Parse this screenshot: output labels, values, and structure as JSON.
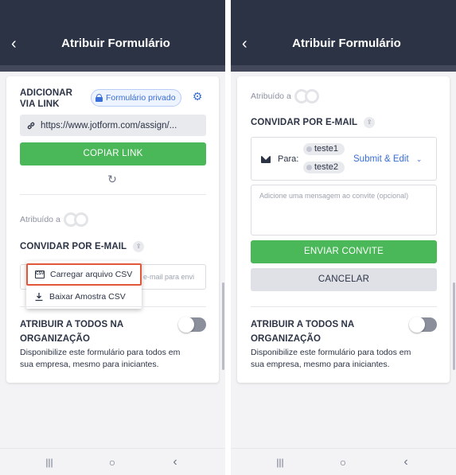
{
  "left": {
    "header": {
      "back": "‹",
      "title": "Atribuir Formulário"
    },
    "add_link": {
      "title": "ADICIONAR VIA LINK",
      "badge": "Formulário privado",
      "url": "https://www.jotform.com/assign/...",
      "copy_button": "COPIAR LINK"
    },
    "assigned_label": "Atribuído a",
    "invite_title": "CONVIDAR POR E-MAIL",
    "email_placeholder": "e-mail para envi",
    "dropdown": {
      "upload_csv": "Carregar arquivo CSV",
      "download_sample": "Baixar Amostra CSV"
    },
    "org": {
      "title": "ATRIBUIR A TODOS NA ORGANIZAÇÃO",
      "desc": "Disponibilize este formulário para todos em sua empresa, mesmo para iniciantes."
    }
  },
  "right": {
    "header": {
      "back": "‹",
      "title": "Atribuir Formulário"
    },
    "assigned_label": "Atribuído a",
    "invite_title": "CONVIDAR POR E-MAIL",
    "to_label": "Para:",
    "recipients": [
      "teste1",
      "teste2"
    ],
    "permission": "Submit & Edit",
    "message_placeholder": "Adicione uma mensagem ao convite (opcional)",
    "send_button": "ENVIAR CONVITE",
    "cancel_button": "CANCELAR",
    "org": {
      "title": "ATRIBUIR A TODOS NA ORGANIZAÇÃO",
      "desc": "Disponibilize este formulário para todos em sua empresa, mesmo para iniciantes."
    }
  },
  "navbar": {
    "recent": "|||",
    "home": "○",
    "back": "‹"
  },
  "colors": {
    "header": "#2c3345",
    "accent_green": "#4ab858",
    "link_blue": "#3a6ed8",
    "highlight": "#e1573a"
  },
  "toggles": {
    "org_left": false,
    "org_right": false
  }
}
